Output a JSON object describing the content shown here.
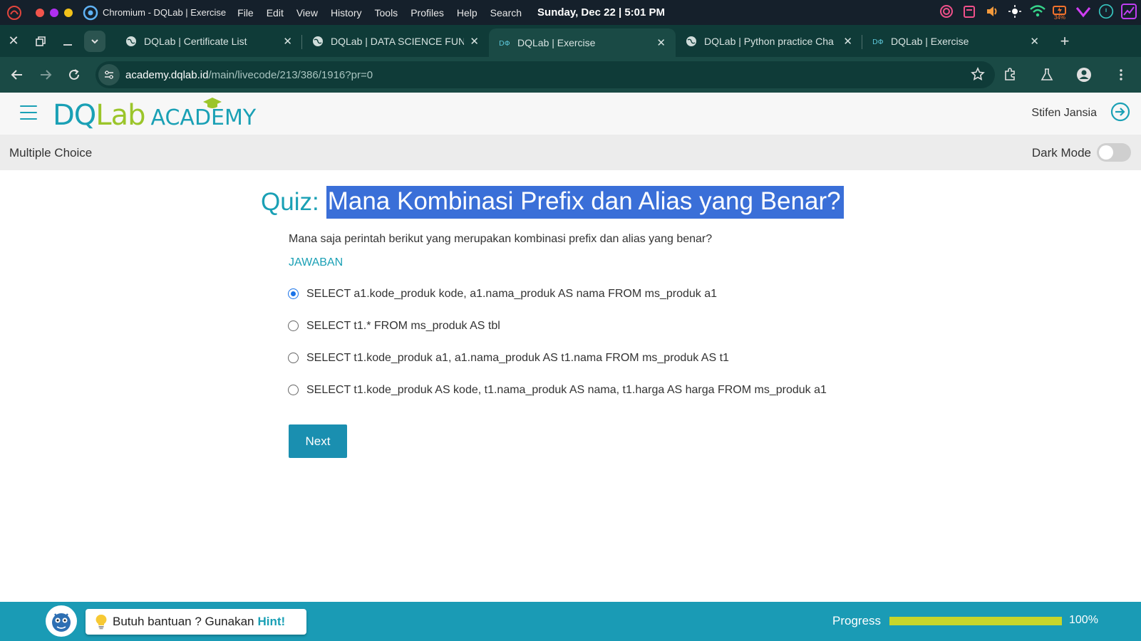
{
  "os": {
    "app_title": "Chromium - DQLab | Exercise",
    "menu": [
      "File",
      "Edit",
      "View",
      "History",
      "Tools",
      "Profiles",
      "Help",
      "Search"
    ],
    "clock": "Sunday, Dec 22 | 5:01 PM",
    "battery": "34%"
  },
  "tabs": [
    {
      "label": "DQLab | Certificate List",
      "icon": "globe-icon",
      "active": false
    },
    {
      "label": "DQLab | DATA SCIENCE FUND",
      "icon": "globe-icon",
      "active": false
    },
    {
      "label": "DQLab | Exercise",
      "icon": "dqlab-icon",
      "active": true
    },
    {
      "label": "DQLab | Python practice Cha",
      "icon": "globe-icon",
      "active": false
    },
    {
      "label": "DQLab | Exercise",
      "icon": "dqlab-icon",
      "active": false
    }
  ],
  "toolbar": {
    "url_host": "academy.dqlab.id",
    "url_path": "/main/livecode/213/386/1916?pr=0"
  },
  "header": {
    "brand_part1": "DQ",
    "brand_part2": "Lab",
    "brand_part3": "ACADEMY",
    "user_name": "Stifen Jansia"
  },
  "subheader": {
    "section": "Multiple Choice",
    "dark_mode_label": "Dark Mode",
    "dark_mode_on": false
  },
  "quiz": {
    "prefix": "Quiz:",
    "title": "Mana Kombinasi Prefix dan Alias yang Benar?",
    "question": "Mana saja perintah berikut yang merupakan kombinasi prefix dan alias yang benar?",
    "answer_label": "JAWABAN",
    "options": [
      {
        "text": "SELECT a1.kode_produk kode, a1.nama_produk AS nama FROM ms_produk a1",
        "selected": true
      },
      {
        "text": "SELECT t1.* FROM ms_produk AS tbl",
        "selected": false
      },
      {
        "text": "SELECT t1.kode_produk a1, a1.nama_produk AS t1.nama FROM ms_produk AS t1",
        "selected": false
      },
      {
        "text": "SELECT t1.kode_produk AS kode, t1.nama_produk AS nama, t1.harga AS harga FROM ms_produk a1",
        "selected": false
      }
    ],
    "next_label": "Next"
  },
  "footer": {
    "hint_text": "Butuh bantuan ? Gunakan",
    "hint_word": "Hint!",
    "progress_label": "Progress",
    "progress_fraction": 1.0,
    "progress_text": "100%"
  },
  "colors": {
    "brand": "#1aa0b5",
    "brand_green": "#9bc52a",
    "selection": "#3a6fd8",
    "progress_fill": "#c7d62a"
  }
}
